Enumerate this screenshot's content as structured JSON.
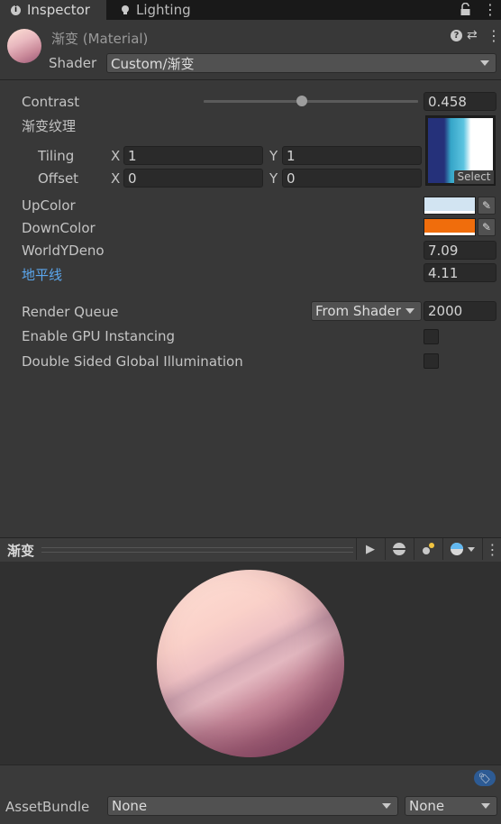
{
  "tabs": [
    {
      "label": "Inspector",
      "icon": "info-icon"
    },
    {
      "label": "Lighting",
      "icon": "bulb-icon"
    }
  ],
  "material": {
    "title": "渐变 (Material)",
    "shader_label": "Shader",
    "shader_value": "Custom/渐变"
  },
  "properties": {
    "contrast": {
      "label": "Contrast",
      "value": "0.458",
      "slider_fraction": 0.458
    },
    "ramp": {
      "label": "渐变纹理",
      "select_label": "Select",
      "tiling": {
        "label": "Tiling",
        "x_label": "X",
        "x": "1",
        "y_label": "Y",
        "y": "1"
      },
      "offset": {
        "label": "Offset",
        "x_label": "X",
        "x": "0",
        "y_label": "Y",
        "y": "0"
      }
    },
    "up_color": {
      "label": "UpColor",
      "color": "#d2e4f2"
    },
    "down_color": {
      "label": "DownColor",
      "color": "#f06d0c"
    },
    "world_y_deno": {
      "label": "WorldYDeno",
      "value": "7.09"
    },
    "horizon": {
      "label": "地平线",
      "value": "4.11",
      "color": "#5ba7ee"
    },
    "render_queue": {
      "label": "Render Queue",
      "mode": "From Shader",
      "value": "2000"
    },
    "gpu_instancing": {
      "label": "Enable GPU Instancing",
      "checked": false
    },
    "double_sided_gi": {
      "label": "Double Sided Global Illumination",
      "checked": false
    }
  },
  "preview": {
    "title": "渐变"
  },
  "asset_bundle": {
    "label": "AssetBundle",
    "name": "None",
    "variant": "None"
  }
}
